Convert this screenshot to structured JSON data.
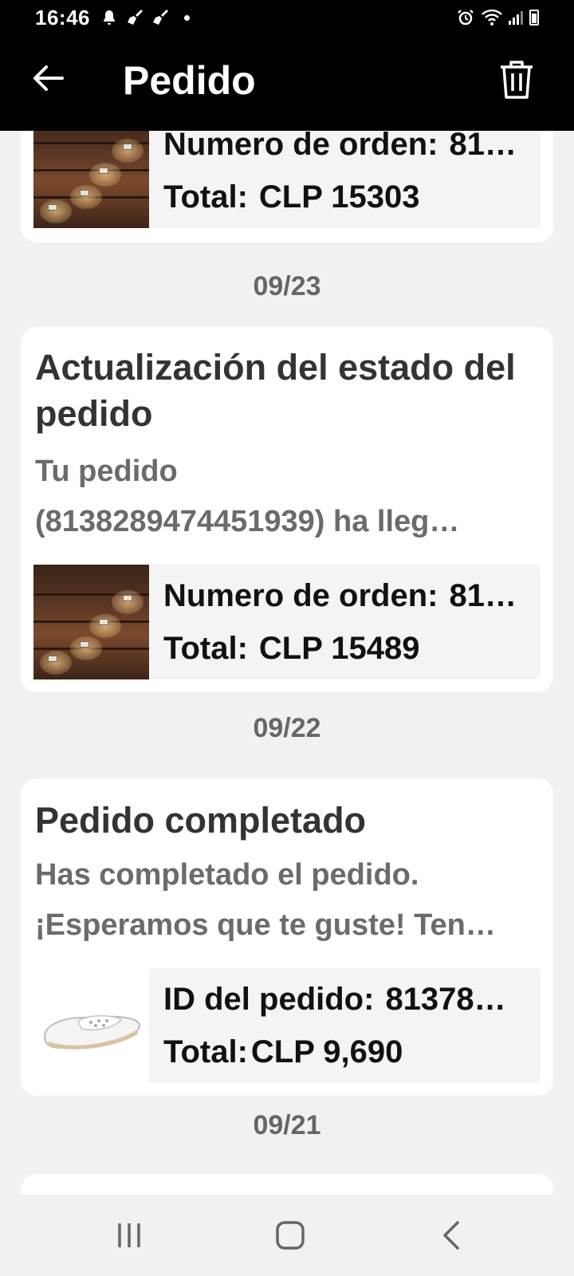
{
  "status_bar": {
    "time": "16:46"
  },
  "header": {
    "title": "Pedido"
  },
  "cards": [
    {
      "order_label": "Numero de orden:",
      "order_value": "81…",
      "total_label": "Total:",
      "total_value": "CLP 15303"
    },
    {
      "date": "09/23",
      "title": "Actualización del estado del pedido",
      "text_line1": "Tu pedido",
      "text_line2": "(8138289474451939) ha lleg…",
      "order_label": "Numero de orden:",
      "order_value": "81…",
      "total_label": "Total:",
      "total_value": "CLP 15489"
    },
    {
      "date": "09/22",
      "title": "Pedido completado",
      "text_line1": "Has completado el pedido.",
      "text_line2": "¡Esperamos que te guste! Ten…",
      "order_label": "ID del pedido:",
      "order_value": "81378…",
      "total_label": "Total:",
      "total_value": "CLP 9,690"
    }
  ],
  "next_date": "09/21",
  "icons": {
    "back": "arrow-left-icon",
    "delete": "trash-icon",
    "recents": "recents-icon",
    "home": "home-icon",
    "nav_back": "chevron-left-icon"
  }
}
